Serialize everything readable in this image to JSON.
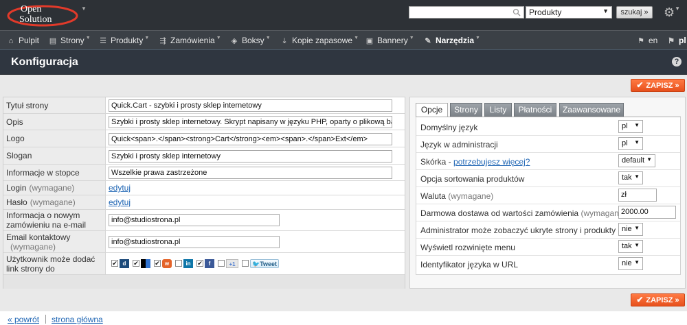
{
  "logo": {
    "line1": "Open",
    "line2": "Solution"
  },
  "top": {
    "search_value": "",
    "search_scope": "Produkty",
    "search_button": "szukaj »"
  },
  "menu": [
    {
      "label": "Pulpit",
      "icon": "home-icon"
    },
    {
      "label": "Strony",
      "icon": "pages-icon"
    },
    {
      "label": "Produkty",
      "icon": "list-icon"
    },
    {
      "label": "Zamówienia",
      "icon": "cart-icon"
    },
    {
      "label": "Boksy",
      "icon": "box-icon"
    },
    {
      "label": "Kopie zapasowe",
      "icon": "download-icon"
    },
    {
      "label": "Bannery",
      "icon": "image-icon"
    },
    {
      "label": "Narzędzia",
      "icon": "wrench-icon"
    },
    {
      "label": "en",
      "icon": "flag-icon"
    },
    {
      "label": "pl",
      "icon": "flag-icon"
    }
  ],
  "page_title": "Konfiguracja",
  "help_icon": "?",
  "save_label": "ZAPISZ »",
  "fields": {
    "title": {
      "label": "Tytuł strony",
      "value": "Quick.Cart - szybki i prosty sklep internetowy"
    },
    "description": {
      "label": "Opis",
      "value": "Szybki i prosty sklep internetowy. Skrypt napisany w języku PHP, oparty o plikową bazę"
    },
    "logo": {
      "label": "Logo",
      "value": "Quick<span>.</span><strong>Cart</strong><em><span>.</span>Ext</em>"
    },
    "slogan": {
      "label": "Slogan",
      "value": "Szybki i prosty sklep internetowy"
    },
    "footer_info": {
      "label": "Informacje w stopce",
      "value": "Wszelkie prawa zastrzeżone"
    },
    "login": {
      "label": "Login",
      "req": "(wymagane)",
      "link": "edytuj"
    },
    "password": {
      "label": "Hasło",
      "req": "(wymagane)",
      "link": "edytuj"
    },
    "order_email": {
      "label": "Informacja o nowym zamówieniu na e-mail",
      "value": "info@studiostrona.pl"
    },
    "contact_email": {
      "label": "Email kontaktowy",
      "req": "(wymagane)",
      "value": "info@studiostrona.pl"
    },
    "share": {
      "label": "Użytkownik może dodać link strony do",
      "tweet": "Tweet"
    }
  },
  "tabs": [
    "Opcje",
    "Strony",
    "Listy",
    "Płatności",
    "Zaawansowane"
  ],
  "options": {
    "default_lang": {
      "label": "Domyślny język",
      "value": "pl"
    },
    "admin_lang": {
      "label": "Język w administracji",
      "value": "pl"
    },
    "skin": {
      "label": "Skórka - ",
      "link": "potrzebujesz więcej?",
      "value": "default"
    },
    "sort": {
      "label": "Opcja sortowania produktów",
      "value": "tak"
    },
    "currency": {
      "label": "Waluta",
      "req": "(wymagane)",
      "value": "zł"
    },
    "free_shipping": {
      "label": "Darmowa dostawa od wartości zamówienia",
      "req": "(wymagane)",
      "value": "2000.00"
    },
    "admin_hidden": {
      "label": "Administrator może zobaczyć ukryte strony i produkty",
      "value": "nie"
    },
    "expanded_menu": {
      "label": "Wyświetl rozwinięte menu",
      "value": "tak"
    },
    "lang_in_url": {
      "label": "Identyfikator języka w URL",
      "value": "nie"
    }
  },
  "footer": {
    "back": "« powrót",
    "home": "strona główna"
  },
  "colors": {
    "accent": "#ef5a22",
    "link": "#2167b5",
    "header": "#2d3136"
  }
}
